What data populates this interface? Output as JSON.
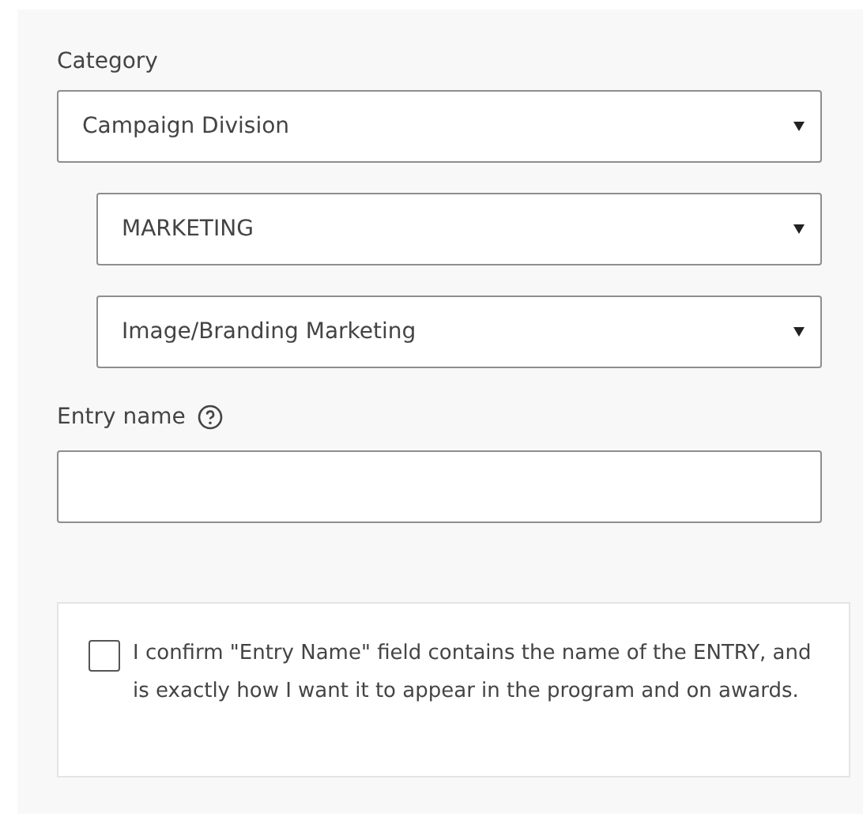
{
  "category": {
    "label": "Category",
    "selects": [
      {
        "value": "Campaign Division",
        "nested": false
      },
      {
        "value": "MARKETING",
        "nested": true
      },
      {
        "value": "Image/Branding Marketing",
        "nested": true
      }
    ]
  },
  "entry_name": {
    "label": "Entry name"
  },
  "confirm": {
    "checked": false,
    "text": "I confirm \"Entry Name\" field contains the name of the ENTRY, and is exactly how I want it to appear in the program and on awards."
  }
}
